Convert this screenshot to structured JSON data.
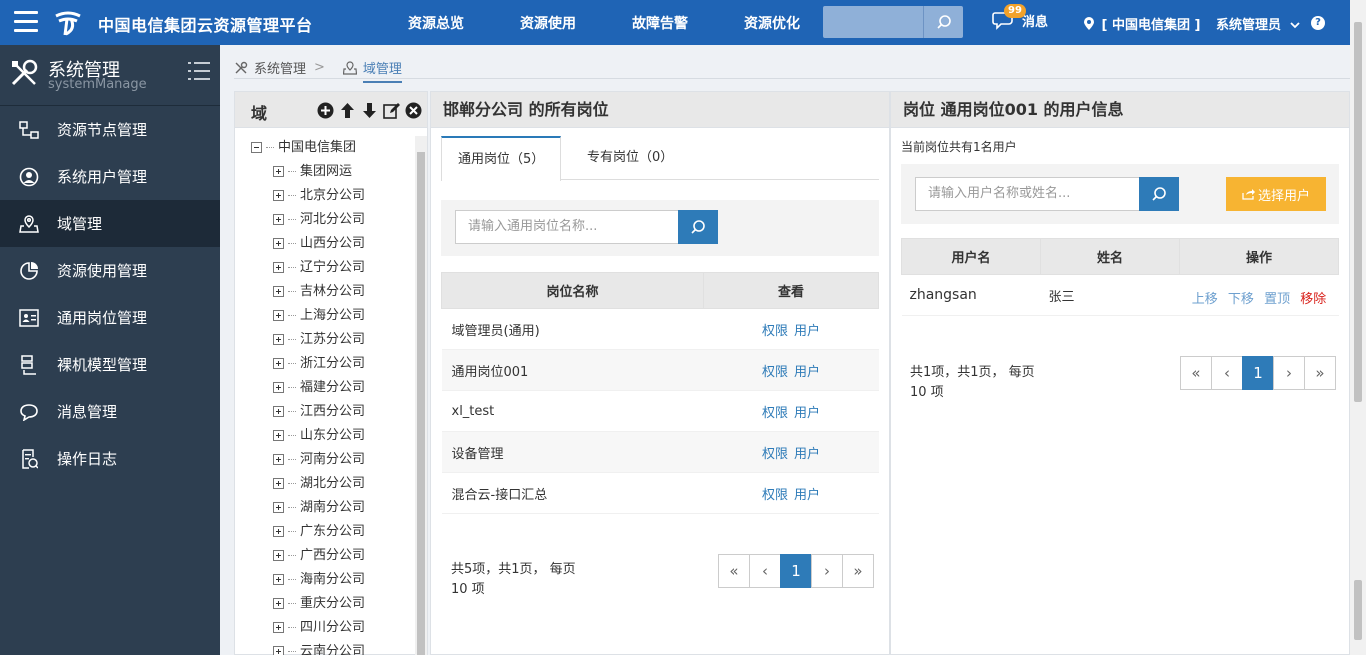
{
  "header": {
    "title": "中国电信集团云资源管理平台",
    "nav": [
      "资源总览",
      "资源使用",
      "故障告警",
      "资源优化"
    ],
    "message_count": "99",
    "message_label": "消息",
    "org": "[ 中国电信集团 ]",
    "user": "系统管理员"
  },
  "sidebar": {
    "title": "系统管理",
    "subtitle": "systemManage",
    "items": [
      {
        "label": "资源节点管理",
        "icon": "resource-node-icon"
      },
      {
        "label": "系统用户管理",
        "icon": "user-circle-icon"
      },
      {
        "label": "域管理",
        "icon": "domain-icon"
      },
      {
        "label": "资源使用管理",
        "icon": "resource-usage-icon"
      },
      {
        "label": "通用岗位管理",
        "icon": "id-card-icon"
      },
      {
        "label": "裸机模型管理",
        "icon": "server-icon"
      },
      {
        "label": "消息管理",
        "icon": "chat-icon"
      },
      {
        "label": "操作日志",
        "icon": "log-icon"
      }
    ],
    "active_index": 2
  },
  "breadcrumb": {
    "parent": "系统管理",
    "current": "域管理"
  },
  "tree": {
    "title": "域",
    "root": "中国电信集团",
    "children": [
      "集团网运",
      "北京分公司",
      "河北分公司",
      "山西分公司",
      "辽宁分公司",
      "吉林分公司",
      "上海分公司",
      "江苏分公司",
      "浙江分公司",
      "福建分公司",
      "江西分公司",
      "山东分公司",
      "河南分公司",
      "湖北分公司",
      "湖南分公司",
      "广东分公司",
      "广西分公司",
      "海南分公司",
      "重庆分公司",
      "四川分公司",
      "云南分公司"
    ]
  },
  "posts": {
    "title": "邯郸分公司 的所有岗位",
    "tab_general": "通用岗位（5）",
    "tab_special": "专有岗位（0）",
    "search_placeholder": "请输入通用岗位名称...",
    "col_name": "岗位名称",
    "col_view": "查看",
    "rows": [
      "域管理员(通用)",
      "通用岗位001",
      "xl_test",
      "设备管理",
      "混合云-接口汇总"
    ],
    "link_perm": "权限",
    "link_user": "用户",
    "pager_info_1": "共5项，共1页，  每页",
    "pager_info_2": "10  项",
    "page": "1"
  },
  "users": {
    "title": "岗位 通用岗位001 的用户信息",
    "summary": "当前岗位共有1名用户",
    "search_placeholder": "请输入用户名称或姓名...",
    "select_button": "选择用户",
    "col_username": "用户名",
    "col_name": "姓名",
    "col_ops": "操作",
    "row": {
      "username": "zhangsan",
      "name": "张三"
    },
    "ops": [
      "上移",
      "下移",
      "置顶",
      "移除"
    ],
    "pager_info_1": "共1项，共1页，  每页",
    "pager_info_2": "10  项",
    "page": "1"
  },
  "pager_symbols": {
    "first": "«",
    "prev": "‹",
    "next": "›",
    "last": "»"
  },
  "colors": {
    "topbar": "#1f64b5",
    "sidebar": "#2d3e50",
    "accent": "#2e7bb8",
    "warning": "#f7b432",
    "danger": "#d9221c"
  }
}
